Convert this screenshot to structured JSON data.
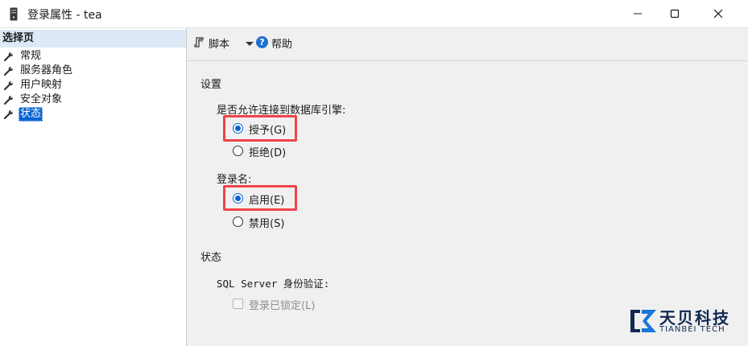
{
  "window": {
    "title": "登录属性 - tea"
  },
  "left_panel": {
    "header": "选择页",
    "items": [
      {
        "label": "常规",
        "icon": "wrench-icon",
        "selected": false
      },
      {
        "label": "服务器角色",
        "icon": "wrench-icon",
        "selected": false
      },
      {
        "label": "用户映射",
        "icon": "wrench-icon",
        "selected": false
      },
      {
        "label": "安全对象",
        "icon": "wrench-icon",
        "selected": false
      },
      {
        "label": "状态",
        "icon": "wrench-icon",
        "selected": true
      }
    ]
  },
  "toolbar": {
    "script_label": "脚本",
    "help_label": "帮助"
  },
  "settings": {
    "section_label": "设置",
    "permission_question": "是否允许连接到数据库引擎:",
    "permission_options": [
      {
        "label": "授予(G)",
        "checked": true,
        "highlighted": true
      },
      {
        "label": "拒绝(D)",
        "checked": false,
        "highlighted": false
      }
    ],
    "login_label": "登录名:",
    "login_options": [
      {
        "label": "启用(E)",
        "checked": true,
        "highlighted": true
      },
      {
        "label": "禁用(S)",
        "checked": false,
        "highlighted": false
      }
    ]
  },
  "status": {
    "section_label": "状态",
    "auth_label": "SQL Server 身份验证:",
    "locked_label": "登录已锁定(L)",
    "locked_checked": false,
    "locked_enabled": false
  },
  "watermark": {
    "brand_cn": "天贝科技",
    "brand_en": "TIANBEI TECH"
  },
  "colors": {
    "accent": "#0a64d2",
    "highlight_box": "#f0434a",
    "left_header_bg": "#dde9f6",
    "panel_bg": "#f0f0f0"
  }
}
